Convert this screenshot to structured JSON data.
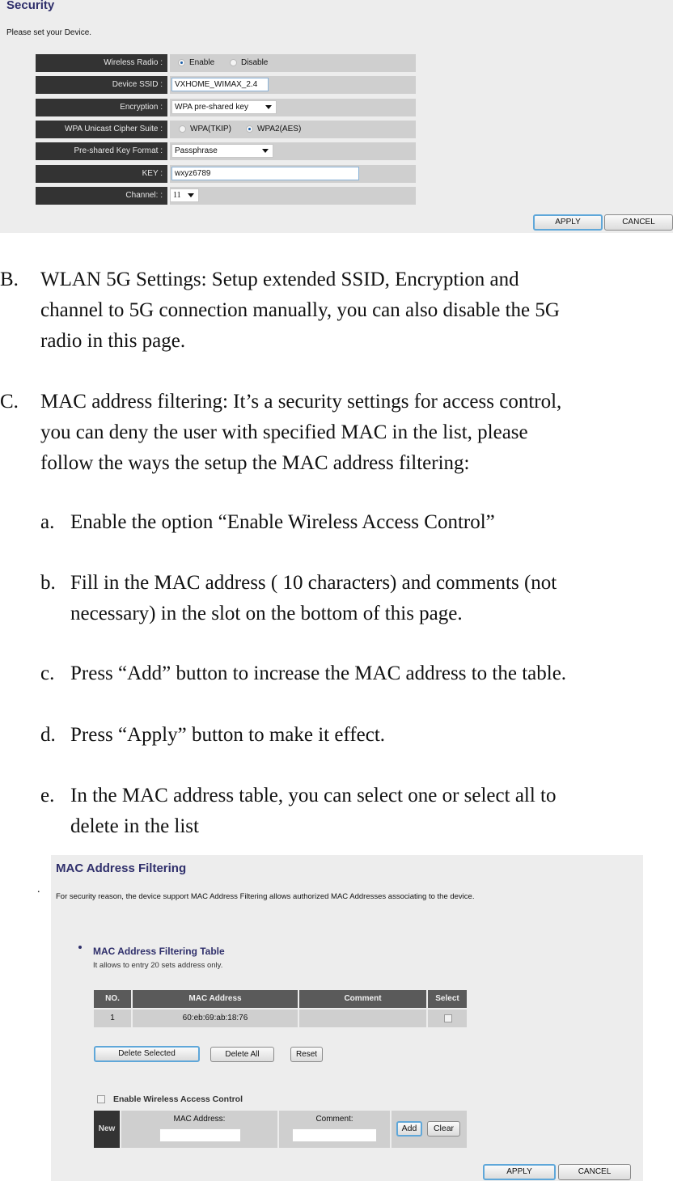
{
  "security_panel": {
    "title": "Security",
    "subtitle": "Please set your Device.",
    "rows": {
      "wireless_radio": {
        "label": "Wireless Radio :",
        "options": [
          "Enable",
          "Disable"
        ],
        "selected": "Enable"
      },
      "device_ssid": {
        "label": "Device SSID :",
        "value": "VXHOME_WIMAX_2.4"
      },
      "encryption": {
        "label": "Encryption :",
        "value": "WPA pre-shared key"
      },
      "cipher_suite": {
        "label": "WPA Unicast Cipher Suite :",
        "options": [
          "WPA(TKIP)",
          "WPA2(AES)"
        ],
        "selected": "WPA2(AES)"
      },
      "key_format": {
        "label": "Pre-shared Key Format :",
        "value": "Passphrase"
      },
      "key": {
        "label": "KEY :",
        "value": "wxyz6789"
      },
      "channel": {
        "label": "Channel: :",
        "value": "11"
      }
    },
    "apply_label": "APPLY",
    "cancel_label": "CANCEL"
  },
  "document": {
    "items": [
      {
        "marker": "B.",
        "lines": [
          "WLAN 5G Settings: Setup extended SSID, Encryption and",
          "channel to 5G connection manually, you can also disable the 5G",
          "radio in this page."
        ]
      },
      {
        "marker": "C.",
        "lines": [
          "MAC address filtering: It’s a security settings for access control,",
          "you can deny the user with specified MAC in the list, please",
          "follow the ways the setup the MAC address filtering:"
        ]
      }
    ],
    "steps": [
      {
        "marker": "a.",
        "lines": [
          "Enable the option “Enable Wireless Access Control”"
        ]
      },
      {
        "marker": "b.",
        "lines": [
          "Fill in the MAC address ( 10 characters) and comments (not",
          "necessary) in the slot on the bottom of this page."
        ]
      },
      {
        "marker": "c.",
        "lines": [
          "Press “Add” button to increase the MAC address to the table."
        ]
      },
      {
        "marker": "d.",
        "lines": [
          "Press “Apply” button to make it effect."
        ]
      },
      {
        "marker": "e.",
        "lines": [
          "In the MAC address table, you can select one or select all to",
          "delete in the list"
        ]
      }
    ],
    "stray_dot": "."
  },
  "mac_panel": {
    "title": "MAC Address Filtering",
    "description": "For security reason, the device support MAC Address Filtering allows authorized MAC Addresses associating to the device.",
    "table_title": "MAC Address Filtering Table",
    "table_subtitle": "It allows to entry 20 sets address only.",
    "columns": [
      "NO.",
      "MAC Address",
      "Comment",
      "Select"
    ],
    "rows": [
      {
        "no": "1",
        "mac": "60:eb:69:ab:18:76",
        "comment": "",
        "selected": false
      }
    ],
    "delete_selected_label": "Delete Selected",
    "delete_all_label": "Delete All",
    "reset_label": "Reset",
    "enable_control_label": "Enable Wireless Access Control",
    "enable_control_checked": false,
    "new_label": "New",
    "mac_field_label": "MAC Address:",
    "mac_field_value": "",
    "comment_field_label": "Comment:",
    "comment_field_value": "",
    "add_label": "Add",
    "clear_label": "Clear",
    "apply_label": "APPLY",
    "cancel_label": "CANCEL"
  }
}
